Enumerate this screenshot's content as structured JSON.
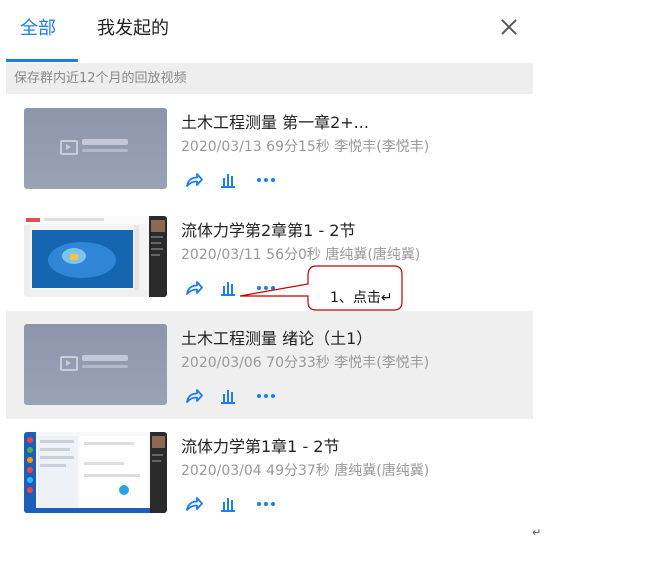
{
  "tabs": [
    {
      "label": "全部",
      "active": true
    },
    {
      "label": "我发起的",
      "active": false
    }
  ],
  "notice": "保存群内近12个月的回放视频",
  "items": [
    {
      "title": "土木工程测量 第一章2+...",
      "date": "2020/03/13",
      "duration": "69分15秒",
      "author": "李悦丰(李悦丰)",
      "thumb": "placeholder",
      "thumb_text": "钉钉群直播",
      "highlighted": false
    },
    {
      "title": "流体力学第2章第1 - 2节",
      "date": "2020/03/11",
      "duration": "56分0秒",
      "author": "唐纯冀(唐纯冀)",
      "thumb": "screen-slide",
      "highlighted": false
    },
    {
      "title": "土木工程测量 绪论（土1）",
      "date": "2020/03/06",
      "duration": "70分33秒",
      "author": "李悦丰(李悦丰)",
      "thumb": "placeholder",
      "thumb_text": "钉钉群直播",
      "highlighted": true
    },
    {
      "title": "流体力学第1章1 - 2节",
      "date": "2020/03/04",
      "duration": "49分37秒",
      "author": "唐纯冀(唐纯冀)",
      "thumb": "screen-chat",
      "highlighted": false
    }
  ],
  "actions": [
    "share-icon",
    "stats-icon",
    "more-icon"
  ],
  "annotation": {
    "text": "1、点击↵"
  },
  "paragraph_mark": "↵",
  "colors": {
    "accent": "#1e7de6",
    "notice_bg": "#eeeeee",
    "highlight_bg": "#efefef",
    "callout_stroke": "#c00000"
  }
}
